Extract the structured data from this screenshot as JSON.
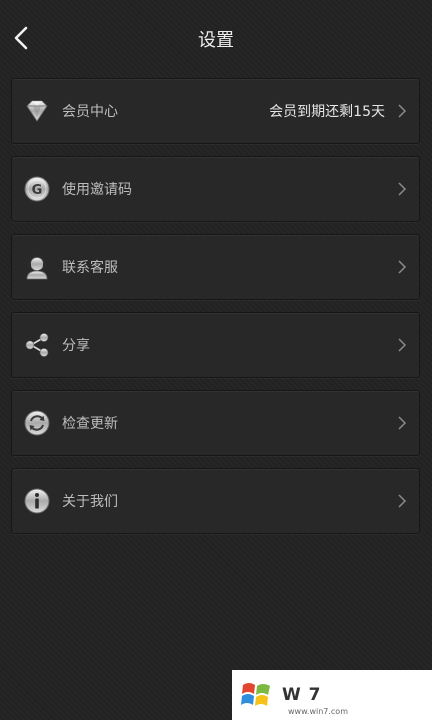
{
  "header": {
    "title": "设置"
  },
  "rows": [
    {
      "label": "会员中心",
      "status": "会员到期还剩15天",
      "icon": "diamond-icon"
    },
    {
      "label": "使用邀请码",
      "icon": "invite-code-icon"
    },
    {
      "label": "联系客服",
      "icon": "customer-service-icon"
    },
    {
      "label": "分享",
      "icon": "share-icon"
    },
    {
      "label": "检查更新",
      "icon": "update-icon"
    },
    {
      "label": "关于我们",
      "icon": "info-icon"
    }
  ],
  "watermark": {
    "text": "W 7",
    "sub": "www.win7.com"
  }
}
